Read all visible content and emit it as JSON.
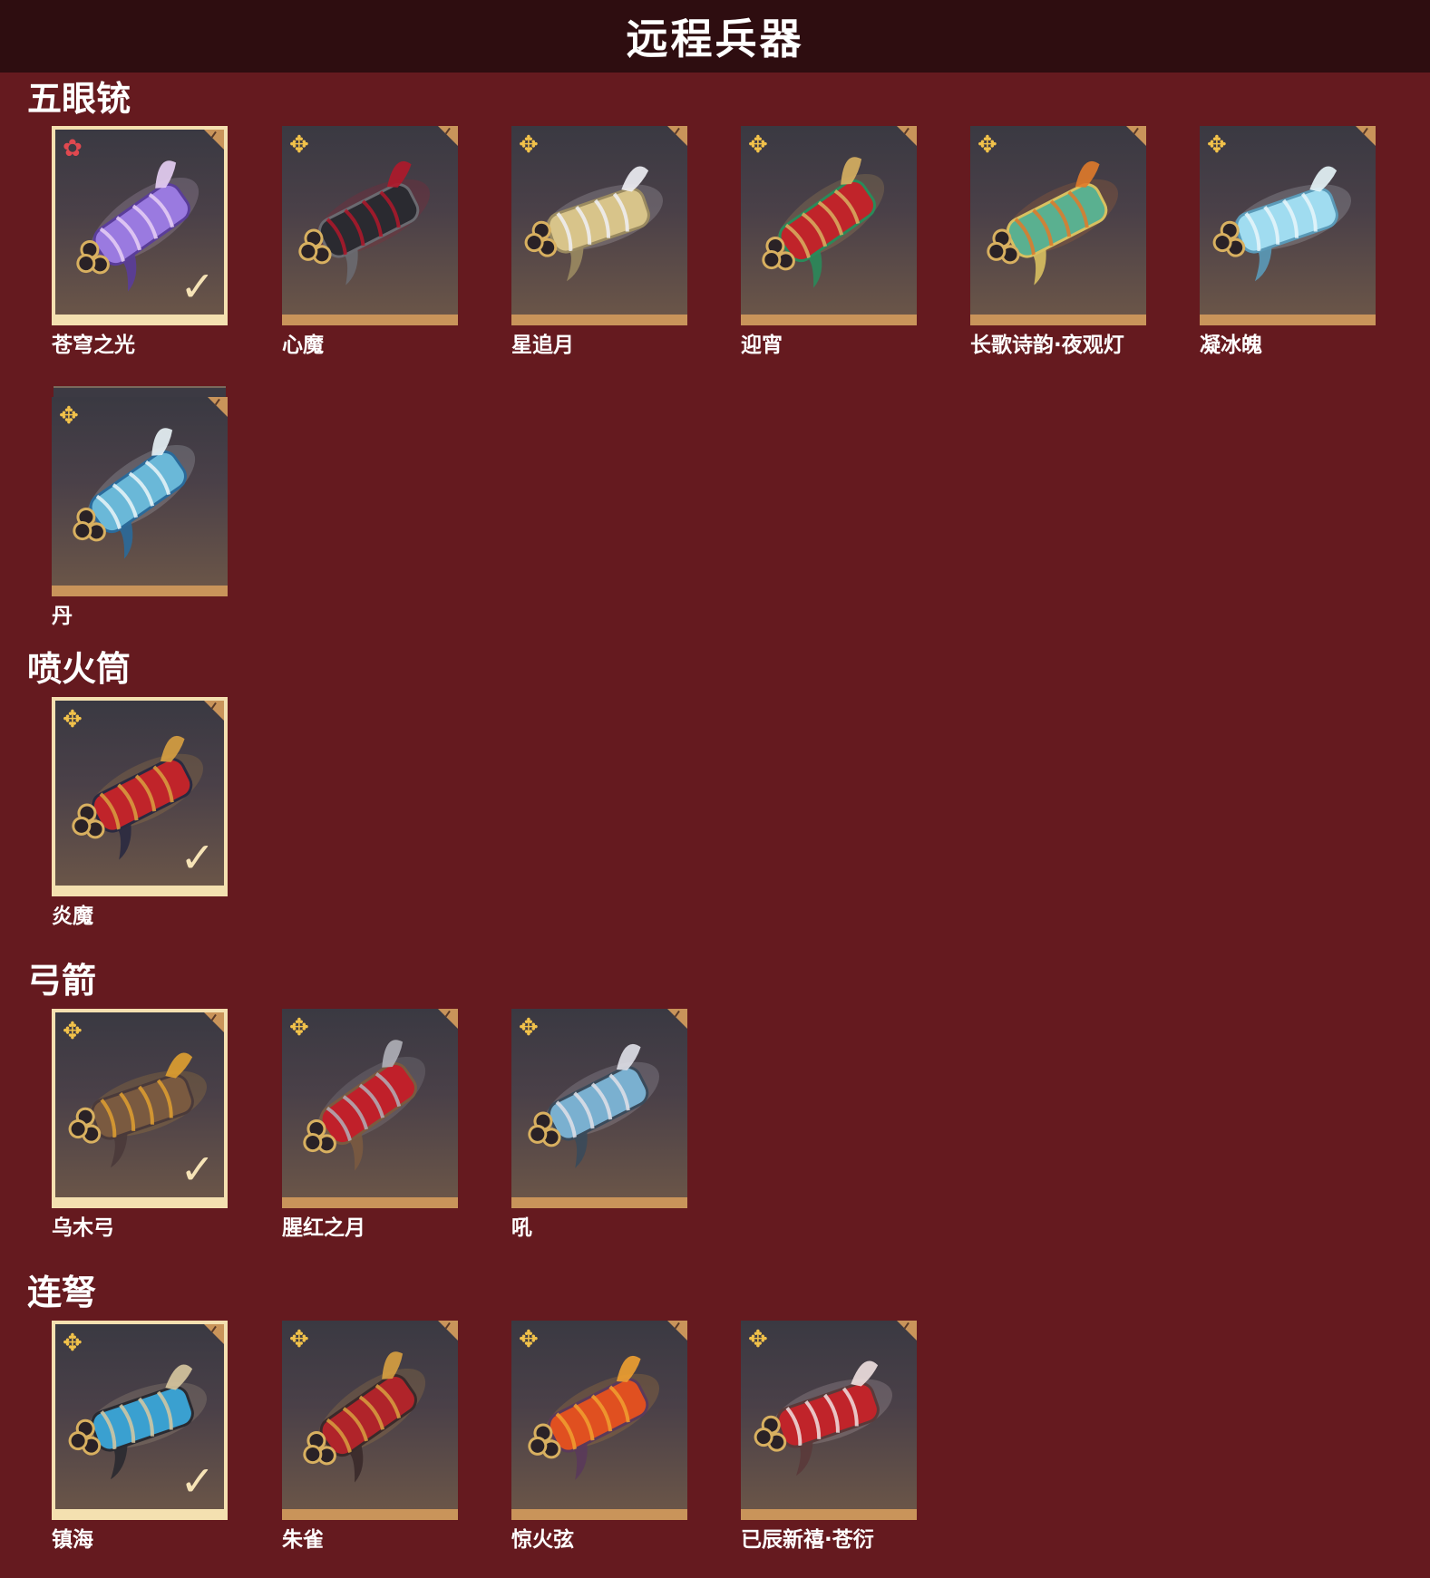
{
  "header": {
    "title": "远程兵器"
  },
  "sections": [
    {
      "title": "五眼铳",
      "items": [
        {
          "name": "苍穹之光",
          "badge": "✿",
          "badge_color": "red",
          "selected": true,
          "palette": [
            "#9a7ae0",
            "#e8d0f5",
            "#5a3d9a"
          ]
        },
        {
          "name": "心魔",
          "badge": "✥",
          "badge_color": "gold",
          "selected": false,
          "palette": [
            "#2a2a30",
            "#b0182a",
            "#6a6a70"
          ]
        },
        {
          "name": "星追月",
          "badge": "✥",
          "badge_color": "gold",
          "selected": false,
          "palette": [
            "#d8c48a",
            "#f0f0f5",
            "#9a8a60"
          ]
        },
        {
          "name": "迎宵",
          "badge": "✥",
          "badge_color": "gold",
          "selected": false,
          "palette": [
            "#c0242a",
            "#d8b060",
            "#2a8a5a"
          ]
        },
        {
          "name": "长歌诗韵·夜观灯",
          "badge": "✥",
          "badge_color": "gold",
          "selected": false,
          "palette": [
            "#5ab090",
            "#e07a2a",
            "#d8c060"
          ]
        },
        {
          "name": "凝冰魄",
          "badge": "✥",
          "badge_color": "gold",
          "selected": false,
          "palette": [
            "#a0dcf0",
            "#e8f6fa",
            "#5a9ab8"
          ]
        },
        {
          "name": "丹",
          "badge": "✥",
          "badge_color": "gold",
          "selected": false,
          "stacked": true,
          "palette": [
            "#6ab8d8",
            "#eaf4f8",
            "#2a6a9a"
          ]
        }
      ]
    },
    {
      "title": "喷火筒",
      "items": [
        {
          "name": "炎魔",
          "badge": "✥",
          "badge_color": "gold",
          "selected": true,
          "palette": [
            "#c0242a",
            "#d8a040",
            "#2a2a40"
          ]
        }
      ]
    },
    {
      "title": "弓箭",
      "items": [
        {
          "name": "乌木弓",
          "badge": "✥",
          "badge_color": "gold",
          "selected": true,
          "palette": [
            "#7a5a40",
            "#e0a030",
            "#4a3a3a"
          ]
        },
        {
          "name": "腥红之月",
          "badge": "✥",
          "badge_color": "gold",
          "selected": false,
          "palette": [
            "#c0202a",
            "#b0b0b8",
            "#7a5a40"
          ]
        },
        {
          "name": "吼",
          "badge": "✥",
          "badge_color": "gold",
          "selected": false,
          "palette": [
            "#7ab0d0",
            "#e0e0e8",
            "#3a4a5a"
          ]
        }
      ]
    },
    {
      "title": "连弩",
      "items": [
        {
          "name": "镇海",
          "badge": "✥",
          "badge_color": "gold",
          "selected": true,
          "palette": [
            "#3aa0d0",
            "#d8c8a0",
            "#2a2a30"
          ]
        },
        {
          "name": "朱雀",
          "badge": "✥",
          "badge_color": "gold",
          "selected": false,
          "palette": [
            "#b0242a",
            "#d8a040",
            "#3a2a2a"
          ]
        },
        {
          "name": "惊火弦",
          "badge": "✥",
          "badge_color": "gold",
          "selected": false,
          "palette": [
            "#e05020",
            "#f0a030",
            "#5a3a5a"
          ]
        },
        {
          "name": "已辰新禧·苍衍",
          "badge": "✥",
          "badge_color": "gold",
          "selected": false,
          "palette": [
            "#c0242a",
            "#f0e0e0",
            "#5a3a3a"
          ]
        }
      ]
    }
  ]
}
